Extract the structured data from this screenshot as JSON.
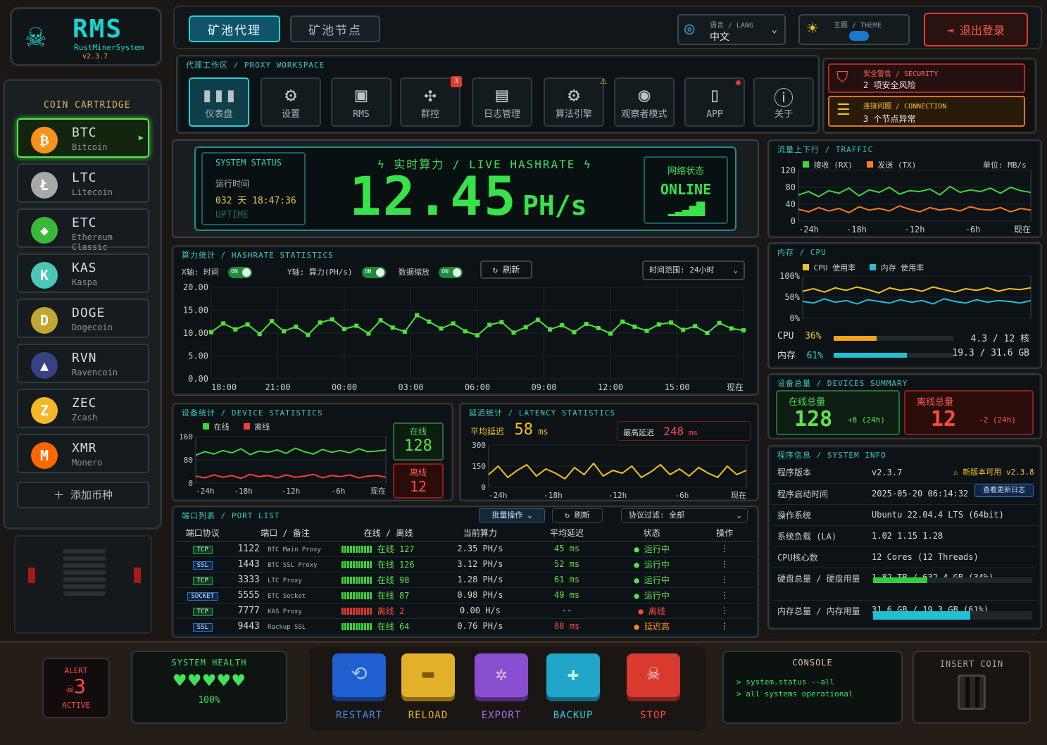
{
  "brand": {
    "name": "RMS",
    "sub": "RustMinerSystem",
    "version": "v2.3.7"
  },
  "nav": {
    "tab_proxy": "矿池代理",
    "tab_node": "矿池节点"
  },
  "lang": {
    "label": "语言 / LANG",
    "value": "中文"
  },
  "theme": {
    "label": "主题 / THEME"
  },
  "logout": "退出登录",
  "cartridge": {
    "title": "COIN CARTRIDGE",
    "add": "添加币种",
    "coins": [
      {
        "sym": "BTC",
        "name": "Bitcoin",
        "color": "#f7931a",
        "glyph": "₿"
      },
      {
        "sym": "LTC",
        "name": "Litecoin",
        "color": "#a6a9aa",
        "glyph": "Ł"
      },
      {
        "sym": "ETC",
        "name": "Ethereum Classic",
        "color": "#3ab83a",
        "glyph": "◆"
      },
      {
        "sym": "KAS",
        "name": "Kaspa",
        "color": "#49c9b5",
        "glyph": "K"
      },
      {
        "sym": "DOGE",
        "name": "Dogecoin",
        "color": "#c2a633",
        "glyph": "D"
      },
      {
        "sym": "RVN",
        "name": "Ravencoin",
        "color": "#384182",
        "glyph": "▲"
      },
      {
        "sym": "ZEC",
        "name": "Zcash",
        "color": "#f4b728",
        "glyph": "Z"
      },
      {
        "sym": "XMR",
        "name": "Monero",
        "color": "#ff6600",
        "glyph": "M"
      }
    ]
  },
  "workspace": {
    "title": "代理工作区",
    "title_en": "PROXY WORKSPACE",
    "tools": [
      {
        "label": "仪表盘",
        "icon": "▮▮▮"
      },
      {
        "label": "设置",
        "icon": "⚙"
      },
      {
        "label": "RMS",
        "icon": "▣"
      },
      {
        "label": "群控",
        "icon": "✣",
        "badge": "3"
      },
      {
        "label": "日志管理",
        "icon": "▤"
      },
      {
        "label": "算法引擎",
        "icon": "⚙",
        "warn": "!"
      },
      {
        "label": "观察者模式",
        "icon": "◉"
      },
      {
        "label": "APP",
        "icon": "▯"
      },
      {
        "label": "关于",
        "icon": "ⓘ"
      }
    ]
  },
  "alerts": {
    "security_label": "安全警告 / SECURITY",
    "security_text": "2 项安全风险",
    "conn_label": "连接问题 / CONNECTION",
    "conn_text": "3 个节点异常"
  },
  "status": {
    "title": "SYSTEM STATUS",
    "runtime_label": "运行时间",
    "runtime": "032 天 18:47:36",
    "uptime": "UPTIME",
    "hash_title": "实时算力 / LIVE HASHRATE",
    "hash_value": "12.45",
    "hash_unit": "PH/s",
    "net_label": "网络状态",
    "net_value": "ONLINE"
  },
  "hashstats": {
    "title": "算力统计",
    "title_en": "HASHRATE STATISTICS",
    "x_label": "X轴: 时间",
    "y_label": "Y轴: 算力(PH/s)",
    "zoom_label": "数据缩放",
    "on": "ON",
    "refresh": "刷新",
    "range": "时间范围: 24小时"
  },
  "traffic": {
    "title": "流量上下行",
    "title_en": "TRAFFIC",
    "rx": "接收 (RX)",
    "tx": "发送 (TX)",
    "unit": "单位: MB/s"
  },
  "mem": {
    "title": "内存",
    "title_en": "CPU",
    "cpu_legend": "CPU 使用率",
    "mem_legend": "内存 使用率",
    "cpu_label": "CPU",
    "cpu_pct": "36%",
    "cpu_val": "4.3 / 12 核",
    "mem_label": "内存",
    "mem_pct": "61%",
    "mem_val": "19.3 / 31.6 GB",
    "cpu_frac": 0.36,
    "mem_frac": 0.61
  },
  "devsum": {
    "title": "设备总量",
    "title_en": "DEVICES SUMMARY",
    "online_label": "在线总量",
    "online": "128",
    "online_delta": "+8 (24h)",
    "offline_label": "离线总量",
    "offline": "12",
    "offline_delta": "-2 (24h)"
  },
  "devstats": {
    "title": "设备统计",
    "title_en": "DEVICE STATISTICS",
    "online": "在线",
    "offline": "离线",
    "online_val": "128",
    "offline_val": "12"
  },
  "latency": {
    "title": "延迟统计",
    "title_en": "LATENCY STATISTICS",
    "avg_label": "平均延迟",
    "avg": "58",
    "avg_unit": "ms",
    "max_label": "最高延迟",
    "max": "248",
    "max_unit": "ms"
  },
  "ports": {
    "title": "端口列表",
    "title_en": "PORT LIST",
    "batch": "批量操作",
    "refresh": "刷新",
    "filter": "协议过滤: 全部",
    "headers": [
      "端口协议",
      "端口 / 备注",
      "在线 / 离线",
      "当前算力",
      "平均延迟",
      "状态",
      "操作"
    ],
    "rows": [
      {
        "proto": "TCP",
        "port": "1122",
        "note": "BTC Main Proxy",
        "online": "在线 127",
        "hash": "2.35 PH/s",
        "lat": "45 ms",
        "status": "运行中",
        "st": "ok"
      },
      {
        "proto": "SSL",
        "port": "1443",
        "note": "BTC SSL Proxy",
        "online": "在线 126",
        "hash": "3.12 PH/s",
        "lat": "52 ms",
        "status": "运行中",
        "st": "ok"
      },
      {
        "proto": "TCP",
        "port": "3333",
        "note": "LTC Proxy",
        "online": "在线 98",
        "hash": "1.28 PH/s",
        "lat": "61 ms",
        "status": "运行中",
        "st": "ok"
      },
      {
        "proto": "SOCKET",
        "port": "5555",
        "note": "ETC Socket",
        "online": "在线 87",
        "hash": "0.98 PH/s",
        "lat": "49 ms",
        "status": "运行中",
        "st": "ok"
      },
      {
        "proto": "TCP",
        "port": "7777",
        "note": "KAS Proxy",
        "online": "离线 2",
        "hash": "0.00 H/s",
        "lat": "--",
        "status": "离线",
        "st": "off"
      },
      {
        "proto": "SSL",
        "port": "9443",
        "note": "Rackup SSL",
        "online": "在线 64",
        "hash": "0.76 PH/s",
        "lat": "88 ms",
        "status": "延迟高",
        "st": "warn"
      }
    ]
  },
  "sysinfo": {
    "title": "程序信息",
    "title_en": "SYSTEM INFO",
    "update_badge": "新版本可用 v2.3.8",
    "update_btn": "查看更新日志",
    "rows": [
      {
        "k": "程序版本",
        "v": "v2.3.7"
      },
      {
        "k": "程序启动时间",
        "v": "2025-05-20 06:14:32"
      },
      {
        "k": "操作系统",
        "v": "Ubuntu 22.04.4 LTS (64bit)"
      },
      {
        "k": "系统负载 (LA)",
        "v": "1.02   1.15   1.28"
      },
      {
        "k": "CPU核心数",
        "v": "12 Cores (12 Threads)"
      },
      {
        "k": "硬盘总量 / 硬盘用量",
        "v": "1.82 TB  /  632.4 GB (34%)"
      },
      {
        "k": "内存总量 / 内存用量",
        "v": "31.6 GB  /  19.3 GB (61%)"
      }
    ],
    "disk_frac": 0.34,
    "mem_frac": 0.61
  },
  "footer": {
    "alert": "ALERT",
    "alert_n": "3",
    "active": "ACTIVE",
    "health": "SYSTEM HEALTH",
    "health_pct": "100%",
    "restart": "RESTART",
    "reload": "RELOAD",
    "export": "EXPORT",
    "backup": "BACKUP",
    "stop": "STOP",
    "console": "CONSOLE",
    "c1": "> system.status --all",
    "c2": "> all systems operational",
    "insert": "INSERT COIN"
  },
  "chart_data": [
    {
      "type": "line",
      "title": "算力统计 / HASHRATE STATISTICS",
      "categories": [
        "18:00",
        "21:00",
        "00:00",
        "03:00",
        "06:00",
        "09:00",
        "12:00",
        "15:00",
        "现在"
      ],
      "ylim": [
        0,
        20
      ],
      "yticks": [
        "20.00",
        "15.00",
        "10.00",
        "5.00",
        "0.00"
      ],
      "series": [
        {
          "values": [
            10.2,
            12.1,
            10.8,
            11.9,
            9.8,
            12.6,
            10.4,
            11.4,
            9.6,
            12.3,
            13.0,
            10.9,
            11.6,
            9.9,
            12.8,
            11.2,
            10.3,
            13.9,
            12.5,
            11.0,
            12.1,
            10.4,
            9.5,
            11.8,
            12.4,
            10.1,
            11.3,
            12.9,
            10.8,
            11.7,
            10.2,
            12.0,
            11.1,
            9.9,
            12.5,
            11.4,
            10.5,
            11.9,
            12.3,
            10.7,
            11.5,
            10.0,
            12.2,
            11.0,
            10.6
          ]
        }
      ]
    },
    {
      "type": "line",
      "title": "流量上下行 / TRAFFIC",
      "categories": [
        "-24h",
        "-18h",
        "-12h",
        "-6h",
        "现在"
      ],
      "ylim": [
        0,
        120
      ],
      "yticks": [
        "120",
        "80",
        "40",
        "0"
      ],
      "series": [
        {
          "name": "接收 (RX)",
          "values": [
            62,
            70,
            58,
            72,
            66,
            78,
            60,
            74,
            68,
            80,
            64,
            72,
            70,
            76,
            62,
            82,
            68,
            74,
            70,
            78,
            66,
            80,
            72,
            68
          ]
        },
        {
          "name": "发送 (TX)",
          "values": [
            28,
            22,
            32,
            24,
            30,
            20,
            34,
            26,
            30,
            24,
            36,
            28,
            22,
            32,
            26,
            30,
            24,
            34,
            28,
            26,
            32,
            22,
            30,
            26
          ]
        }
      ]
    },
    {
      "type": "line",
      "title": "内存 / CPU",
      "categories": [],
      "ylim": [
        0,
        100
      ],
      "yticks": [
        "100%",
        "50%",
        "0%"
      ],
      "series": [
        {
          "name": "CPU 使用率",
          "values": [
            64,
            70,
            62,
            72,
            66,
            74,
            68,
            60,
            72,
            66,
            70,
            64,
            74,
            68,
            62,
            70,
            66,
            72,
            64,
            70,
            68,
            72
          ]
        },
        {
          "name": "内存 使用率",
          "values": [
            40,
            36,
            46,
            38,
            42,
            34,
            44,
            40,
            36,
            44,
            38,
            42,
            34,
            46,
            40,
            36,
            44,
            38,
            42,
            40,
            36,
            42
          ]
        }
      ]
    },
    {
      "type": "line",
      "title": "设备统计 / DEVICE STATISTICS",
      "categories": [
        "-24h",
        "-18h",
        "-12h",
        "-6h",
        "现在"
      ],
      "ylim": [
        0,
        160
      ],
      "yticks": [
        "160",
        "80",
        "0"
      ],
      "series": [
        {
          "name": "在线",
          "values": [
            96,
            108,
            100,
            112,
            104,
            118,
            98,
            110,
            106,
            114,
            102,
            120,
            108,
            100,
            116,
            106,
            112,
            104,
            118,
            108,
            110,
            114
          ]
        },
        {
          "name": "离线",
          "values": [
            24,
            18,
            28,
            20,
            26,
            16,
            30,
            22,
            26,
            18,
            28,
            20,
            24,
            30,
            18,
            26,
            22,
            28,
            18,
            24,
            26,
            20
          ]
        }
      ]
    },
    {
      "type": "line",
      "title": "延迟统计 / LATENCY STATISTICS",
      "categories": [
        "-24h",
        "-18h",
        "-12h",
        "-6h",
        "现在"
      ],
      "ylim": [
        0,
        300
      ],
      "yticks": [
        "300",
        "150",
        "0"
      ],
      "series": [
        {
          "values": [
            90,
            150,
            70,
            120,
            160,
            80,
            130,
            100,
            60,
            140,
            90,
            170,
            80,
            120,
            100,
            150,
            70,
            110,
            160,
            90,
            130,
            80,
            140,
            100,
            70,
            150,
            90,
            120
          ]
        }
      ]
    }
  ]
}
